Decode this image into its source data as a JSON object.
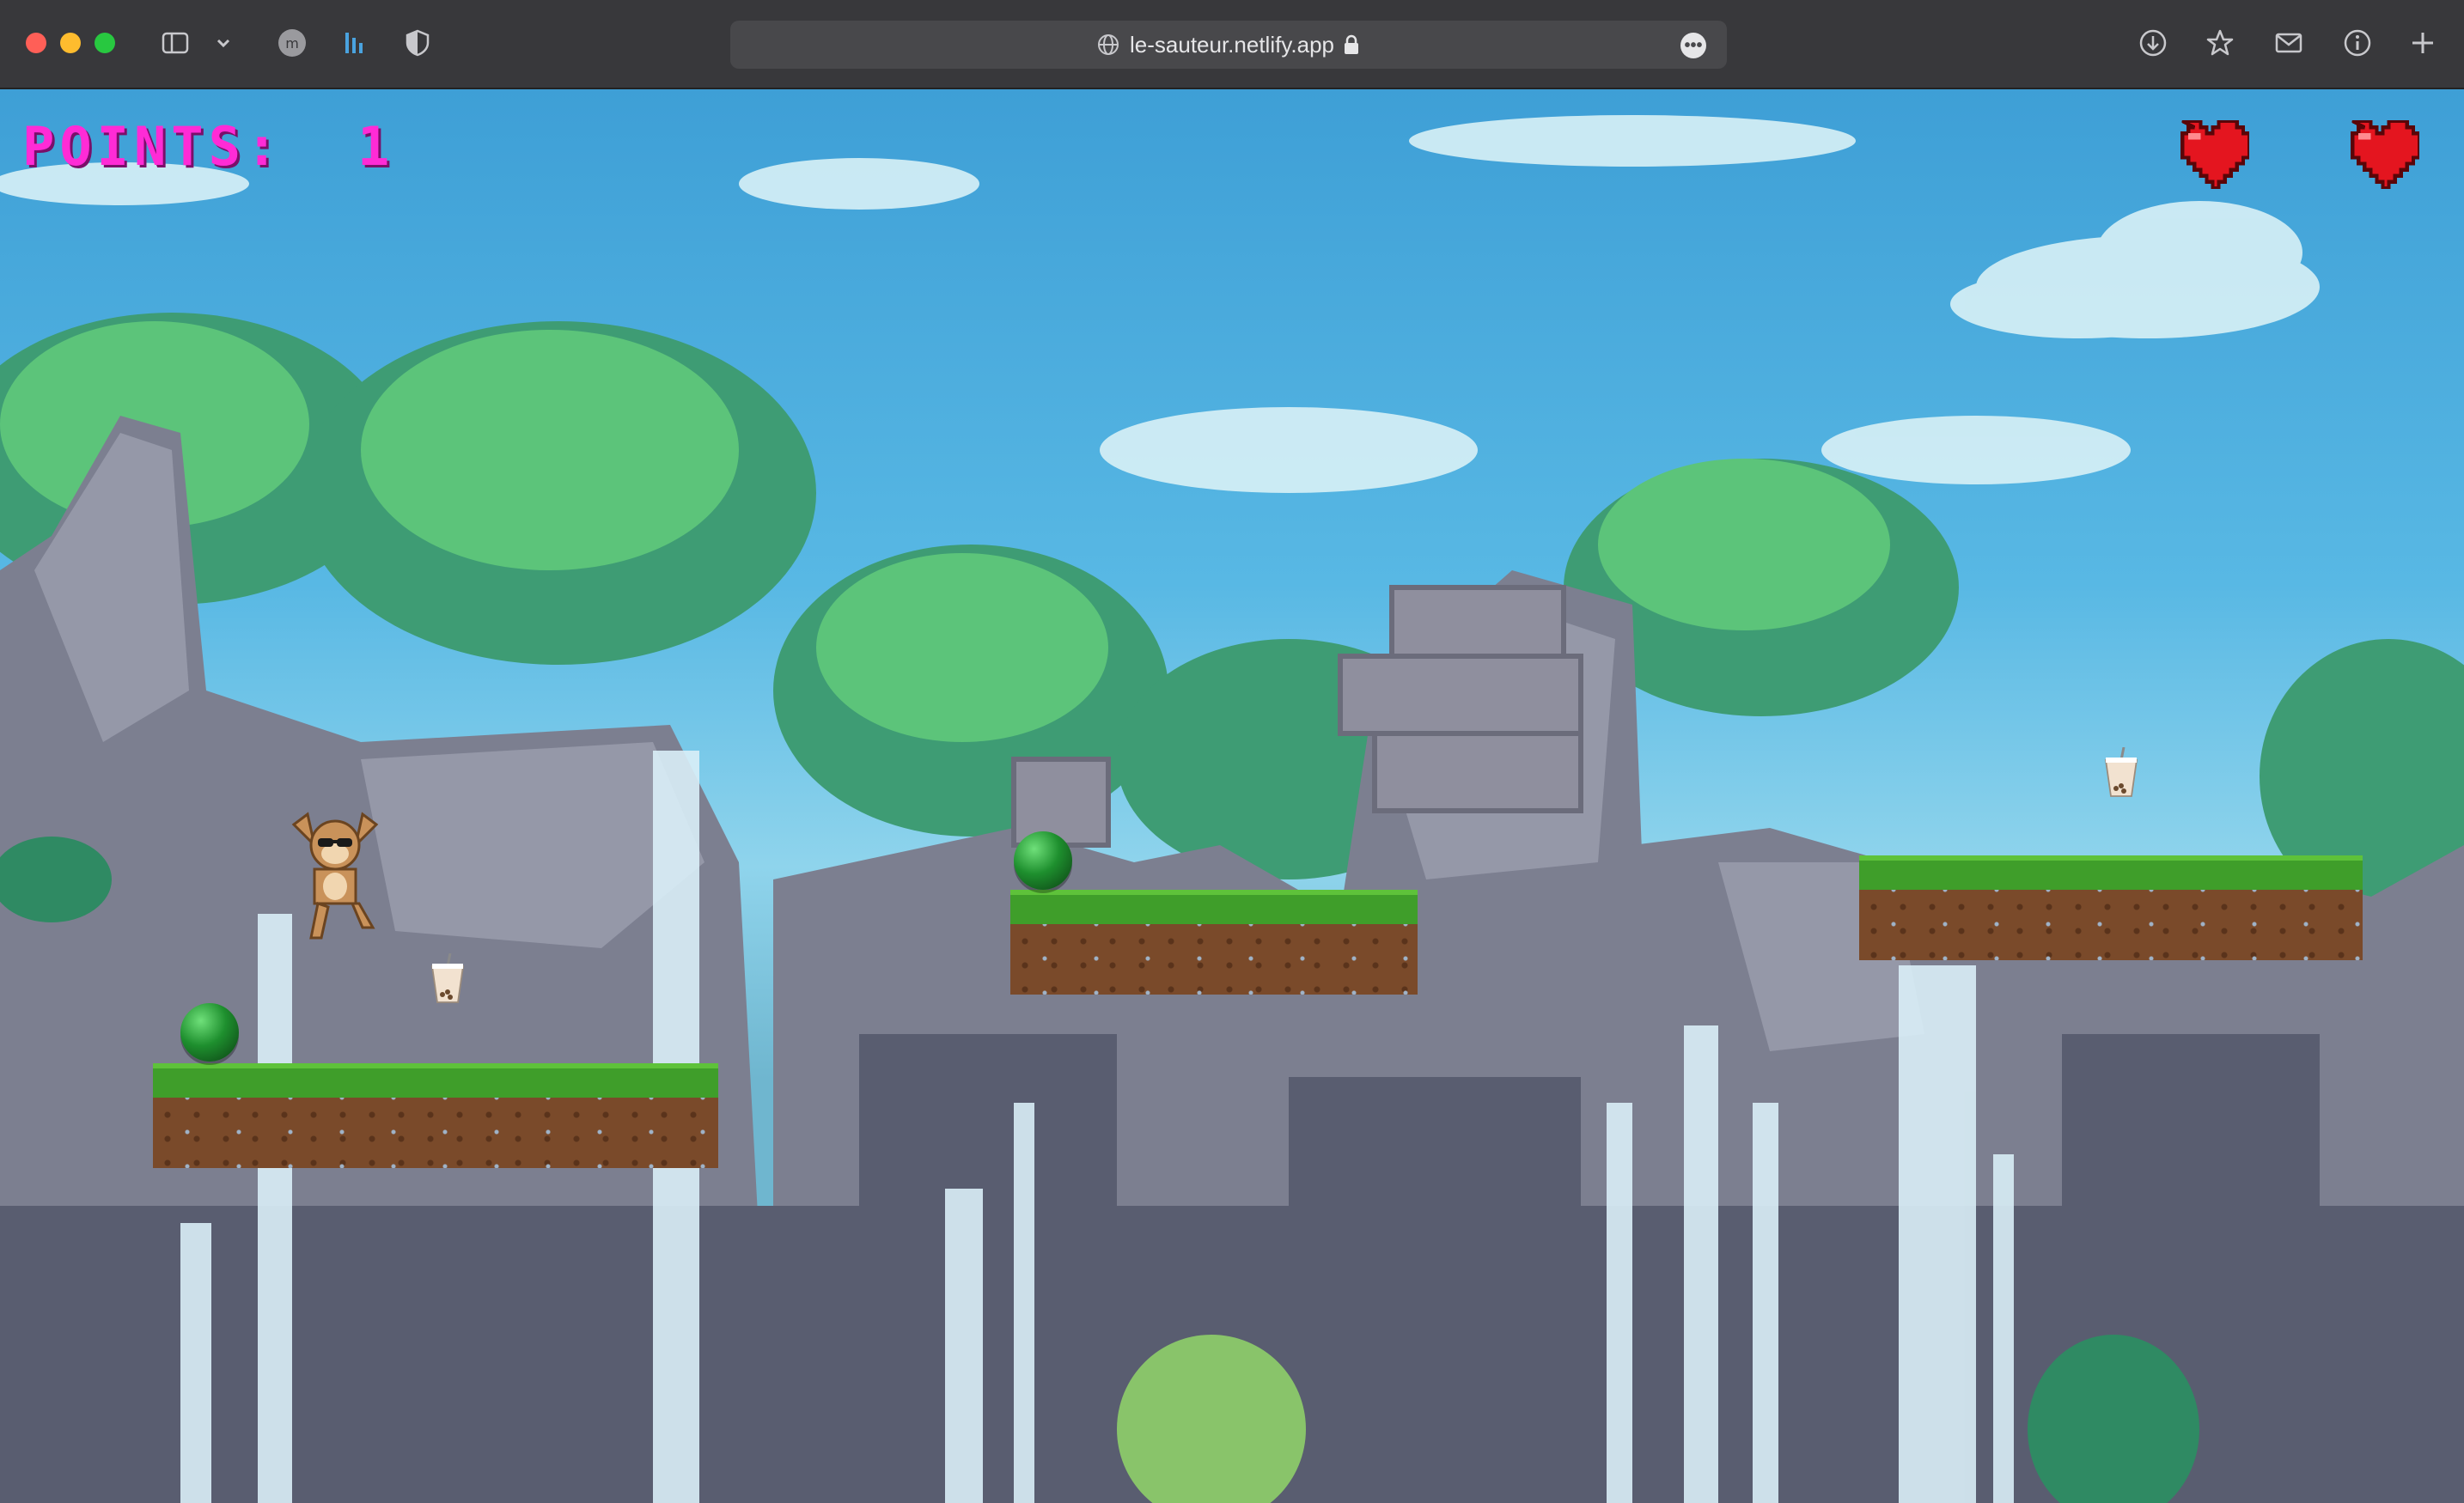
{
  "browser": {
    "url": "le-sauteur.netlify.app",
    "icons": [
      "sidebar-icon",
      "chevron-down-icon",
      "profile-icon",
      "bar-chart-icon",
      "shield-icon",
      "download-icon",
      "star-icon",
      "mail-icon",
      "info-icon",
      "plus-icon"
    ]
  },
  "hud": {
    "points_text": "POINTS:  1",
    "lives": 2,
    "colors": {
      "points": "#ff2bd6",
      "heart": "#e4151f"
    }
  },
  "entities": {
    "platforms": 3,
    "green_orbs": 2,
    "bubble_tea_cups": 2,
    "player": "monkey-with-sunglasses"
  }
}
